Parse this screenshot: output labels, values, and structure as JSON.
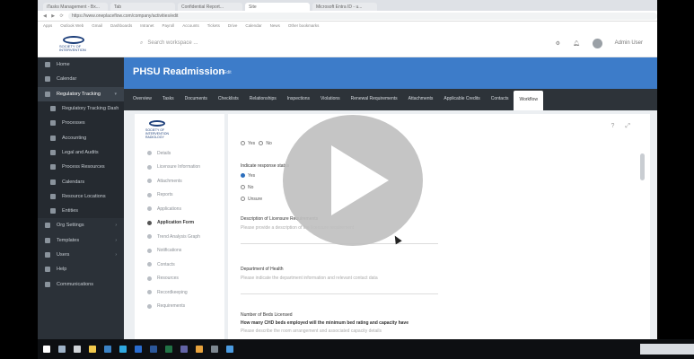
{
  "browser": {
    "tabs": [
      {
        "label": "iTasks Management - Bx..."
      },
      {
        "label": "Tab"
      },
      {
        "label": "Confidential Report..."
      },
      {
        "label": "Site"
      },
      {
        "label": "Microsoft Entra ID - u..."
      }
    ],
    "url": "https://www.oneplaceflow.com/company/activities/edit",
    "bookmarks": [
      "Apps",
      "Outlook Web",
      "Gmail",
      "Dashboards",
      "Intranet",
      "Payroll",
      "Accounts",
      "Tickets",
      "Drive",
      "Calendar",
      "News",
      "Other bookmarks"
    ]
  },
  "app": {
    "search_placeholder": "Search workspace ...",
    "user_name": "Admin User",
    "logo_text": [
      "SOCIETY OF",
      "INTERVENTION",
      "RADIOLOGY"
    ]
  },
  "sidebar": {
    "items": [
      {
        "label": "Home",
        "icon": "home-icon"
      },
      {
        "label": "Calendar",
        "icon": "calendar-icon"
      },
      {
        "label": "Regulatory Tracking",
        "icon": "tracking-icon",
        "active": true
      },
      {
        "label": "Regulatory Tracking Dash",
        "icon": "list-icon",
        "sub": true
      },
      {
        "label": "Processes",
        "icon": "process-icon",
        "sub": true
      },
      {
        "label": "Accounting",
        "icon": "accounting-icon",
        "sub": true
      },
      {
        "label": "Legal and Audits",
        "icon": "legal-icon",
        "sub": true
      },
      {
        "label": "Process Resources",
        "icon": "resources-icon",
        "sub": true
      },
      {
        "label": "Calendars",
        "icon": "calendar-icon",
        "sub": true
      },
      {
        "label": "Resource Locations",
        "icon": "location-icon",
        "sub": true
      },
      {
        "label": "Entities",
        "icon": "entity-icon",
        "sub": true
      },
      {
        "label": "Org Settings",
        "icon": "settings-icon"
      },
      {
        "label": "Templates",
        "icon": "template-icon"
      },
      {
        "label": "Users",
        "icon": "users-icon"
      },
      {
        "label": "Help",
        "icon": "help-icon"
      },
      {
        "label": "Communications",
        "icon": "chat-icon"
      }
    ]
  },
  "banner": {
    "title": "PHSU Readmission",
    "meta": "- Edit"
  },
  "tabnav": [
    "Overview",
    "Tasks",
    "Documents",
    "Checklists",
    "Relationships",
    "Inspections",
    "Violations",
    "Renewal Requirements",
    "Attachments",
    "Applicable Credits",
    "Contacts",
    "Workflow"
  ],
  "active_tab": "Workflow",
  "leftnav": {
    "logo_text": [
      "SOCIETY OF",
      "INTERVENTION",
      "RADIOLOGY"
    ],
    "items": [
      {
        "label": "Details"
      },
      {
        "label": "Licensure Information"
      },
      {
        "label": "Attachments"
      },
      {
        "label": "Reports"
      },
      {
        "label": "Applications"
      },
      {
        "label": "Application Form",
        "active": true
      },
      {
        "label": "Trend Analysis Graph"
      },
      {
        "label": "Notifications"
      },
      {
        "label": "Contacts"
      },
      {
        "label": "Resources"
      },
      {
        "label": "Recordkeeping"
      },
      {
        "label": "Requirements"
      }
    ]
  },
  "form": {
    "top_toggle": [
      "Yes",
      "No"
    ],
    "question1": "Indicate response status",
    "options": [
      "Yes",
      "No",
      "Unsure"
    ],
    "field1_label": "Description of Licensure Requirements",
    "field1_hint": "Please provide a description of the licensure requirement",
    "field2_label": "Department of Health",
    "field2_hint": "Please indicate the department information and relevant contact data",
    "field3_label": "Number of Beds Licensed",
    "field3_text": "How many CHD beds employed will the minimum bed rating and capacity have",
    "field3_hint": "Please describe the room arrangement and associated capacity details"
  },
  "taskbar": {
    "icons": [
      "start-icon",
      "search-icon",
      "taskview-icon",
      "explorer-icon",
      "chrome-icon",
      "edge-icon",
      "outlook-icon",
      "word-icon",
      "excel-icon",
      "teams-icon",
      "files-icon",
      "settings-icon",
      "store-icon"
    ]
  },
  "colors": {
    "banner": "#3d7cc9",
    "sidebar": "#2b3138",
    "tabnav": "#2d3339"
  }
}
